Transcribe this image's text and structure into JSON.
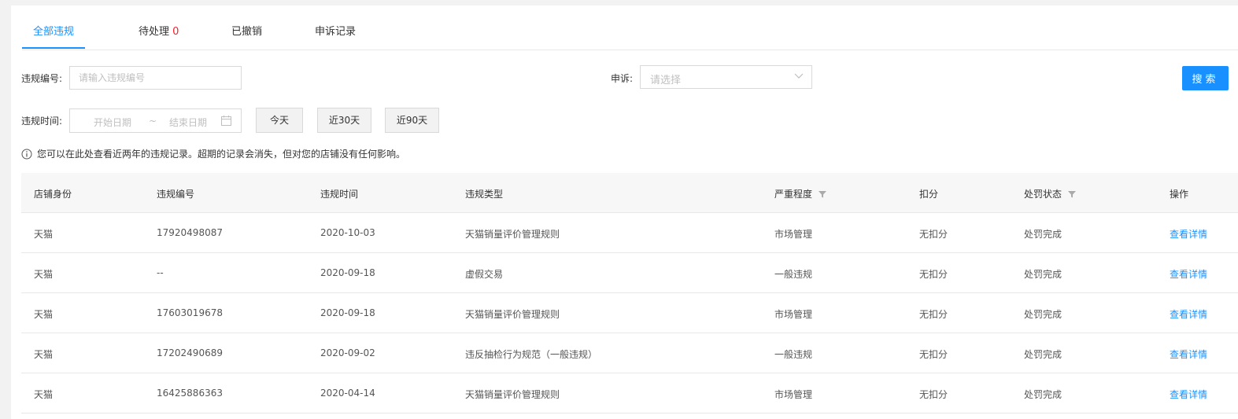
{
  "tabs": [
    {
      "label": "全部违规",
      "count": ""
    },
    {
      "label": "待处理",
      "count": "0"
    },
    {
      "label": "已撤销",
      "count": ""
    },
    {
      "label": "申诉记录",
      "count": ""
    }
  ],
  "filters": {
    "violation_no_label": "违规编号:",
    "violation_no_placeholder": "请输入违规编号",
    "appeal_label": "申诉:",
    "appeal_placeholder": "请选择",
    "search_label": "搜索",
    "time_label": "违规时间:",
    "start_placeholder": "开始日期",
    "range_sep": "~",
    "end_placeholder": "结束日期",
    "quick": [
      "今天",
      "近30天",
      "近90天"
    ]
  },
  "notice": "您可以在此处查看近两年的违规记录。超期的记录会消失，但对您的店铺没有任何影响。",
  "table": {
    "columns": [
      "店铺身份",
      "违规编号",
      "违规时间",
      "违规类型",
      "严重程度",
      "扣分",
      "处罚状态",
      "操作"
    ],
    "rows": [
      [
        "天猫",
        "17920498087",
        "2020-10-03",
        "天猫销量评价管理规则",
        "市场管理",
        "无扣分",
        "处罚完成",
        "查看详情"
      ],
      [
        "天猫",
        "--",
        "2020-09-18",
        "虚假交易",
        "一般违规",
        "无扣分",
        "处罚完成",
        "查看详情"
      ],
      [
        "天猫",
        "17603019678",
        "2020-09-18",
        "天猫销量评价管理规则",
        "市场管理",
        "无扣分",
        "处罚完成",
        "查看详情"
      ],
      [
        "天猫",
        "17202490689",
        "2020-09-02",
        "违反抽检行为规范（一般违规）",
        "一般违规",
        "无扣分",
        "处罚完成",
        "查看详情"
      ],
      [
        "天猫",
        "16425886363",
        "2020-04-14",
        "天猫销量评价管理规则",
        "市场管理",
        "无扣分",
        "处罚完成",
        "查看详情"
      ]
    ]
  },
  "colors": {
    "accent": "#1890ff",
    "count": "#f5222d"
  }
}
